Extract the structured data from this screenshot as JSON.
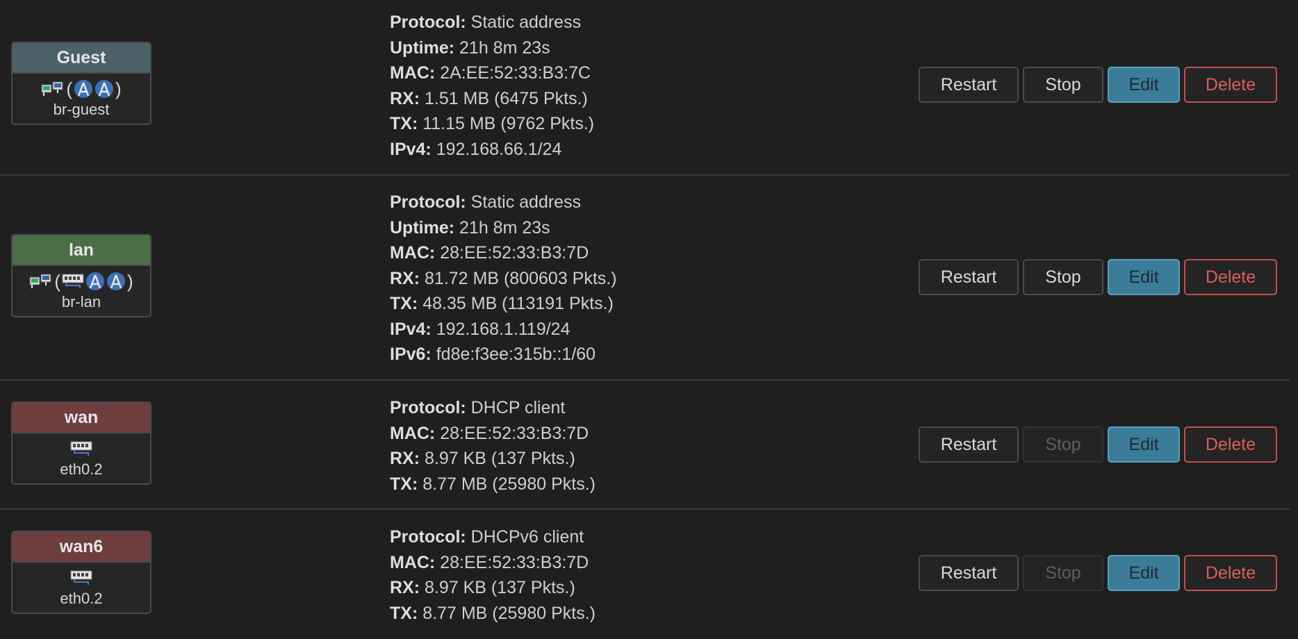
{
  "interfaces": [
    {
      "name": "Guest",
      "head_color": "#4b6167",
      "device": "br-guest",
      "device_icons": [
        "bridge-icon",
        "(",
        "wireless-icon",
        "wireless-icon",
        ")"
      ],
      "info": [
        {
          "label": "Protocol:",
          "value": "Static address"
        },
        {
          "label": "Uptime:",
          "value": "21h 8m 23s"
        },
        {
          "label": "MAC:",
          "value": "2A:EE:52:33:B3:7C"
        },
        {
          "label": "RX:",
          "value": "1.51 MB (6475 Pkts.)"
        },
        {
          "label": "TX:",
          "value": "11.15 MB (9762 Pkts.)"
        },
        {
          "label": "IPv4:",
          "value": "192.168.66.1/24"
        }
      ],
      "buttons": {
        "restart": "Restart",
        "stop": "Stop",
        "edit": "Edit",
        "delete": "Delete"
      },
      "stop_disabled": false
    },
    {
      "name": "lan",
      "head_color": "#4b6e48",
      "device": "br-lan",
      "device_icons": [
        "bridge-icon",
        "(",
        "ethernet-icon",
        "wireless-icon",
        "wireless-icon",
        ")"
      ],
      "info": [
        {
          "label": "Protocol:",
          "value": "Static address"
        },
        {
          "label": "Uptime:",
          "value": "21h 8m 23s"
        },
        {
          "label": "MAC:",
          "value": "28:EE:52:33:B3:7D"
        },
        {
          "label": "RX:",
          "value": "81.72 MB (800603 Pkts.)"
        },
        {
          "label": "TX:",
          "value": "48.35 MB (113191 Pkts.)"
        },
        {
          "label": "IPv4:",
          "value": "192.168.1.119/24"
        },
        {
          "label": "IPv6:",
          "value": "fd8e:f3ee:315b::1/60"
        }
      ],
      "buttons": {
        "restart": "Restart",
        "stop": "Stop",
        "edit": "Edit",
        "delete": "Delete"
      },
      "stop_disabled": false
    },
    {
      "name": "wan",
      "head_color": "#6e3d3d",
      "device": "eth0.2",
      "device_icons": [
        "ethernet-icon"
      ],
      "info": [
        {
          "label": "Protocol:",
          "value": "DHCP client"
        },
        {
          "label": "MAC:",
          "value": "28:EE:52:33:B3:7D"
        },
        {
          "label": "RX:",
          "value": "8.97 KB (137 Pkts.)"
        },
        {
          "label": "TX:",
          "value": "8.77 MB (25980 Pkts.)"
        }
      ],
      "buttons": {
        "restart": "Restart",
        "stop": "Stop",
        "edit": "Edit",
        "delete": "Delete"
      },
      "stop_disabled": true
    },
    {
      "name": "wan6",
      "head_color": "#6e3d3d",
      "device": "eth0.2",
      "device_icons": [
        "ethernet-icon"
      ],
      "info": [
        {
          "label": "Protocol:",
          "value": "DHCPv6 client"
        },
        {
          "label": "MAC:",
          "value": "28:EE:52:33:B3:7D"
        },
        {
          "label": "RX:",
          "value": "8.97 KB (137 Pkts.)"
        },
        {
          "label": "TX:",
          "value": "8.77 MB (25980 Pkts.)"
        }
      ],
      "buttons": {
        "restart": "Restart",
        "stop": "Stop",
        "edit": "Edit",
        "delete": "Delete"
      },
      "stop_disabled": true
    }
  ]
}
